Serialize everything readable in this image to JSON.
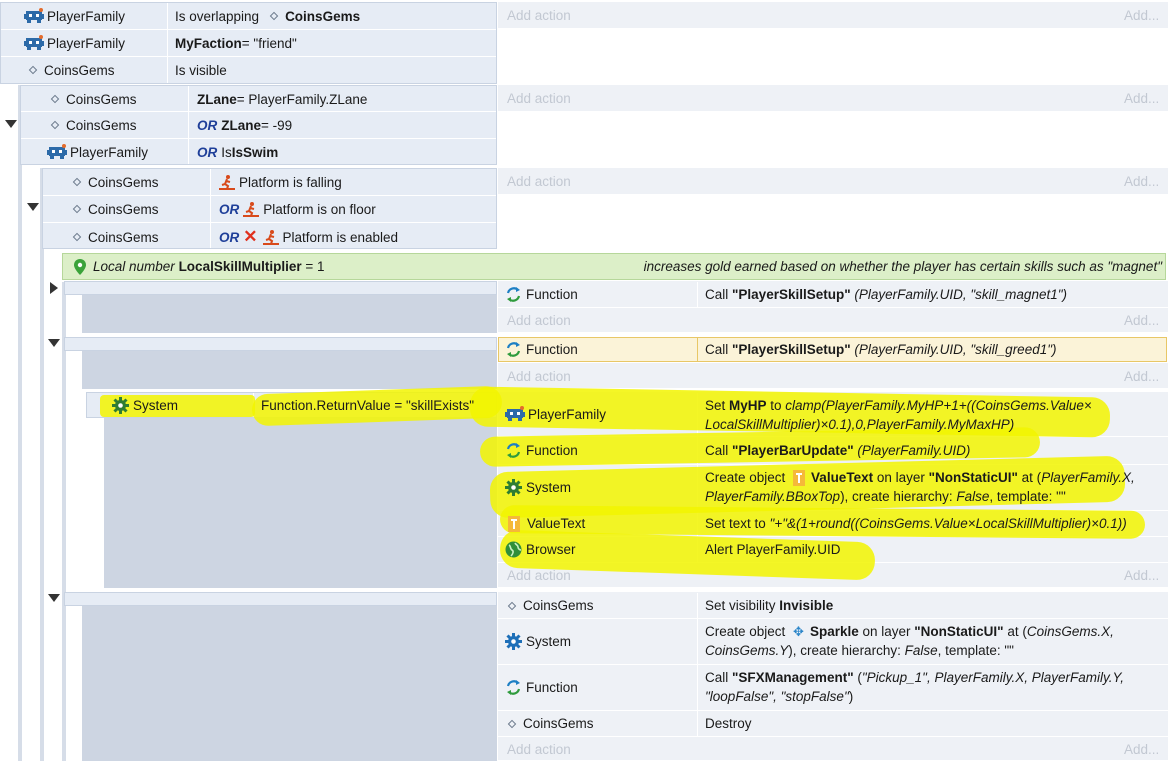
{
  "add_action": "Add action",
  "add_dots": "Add...",
  "block1": {
    "rows": [
      {
        "obj": "PlayerFamily",
        "cond_pre": "Is overlapping",
        "cond_bold": "CoinsGems"
      },
      {
        "obj": "PlayerFamily",
        "cond_bold": "MyFaction",
        "cond_post": " = \"friend\""
      },
      {
        "obj": "CoinsGems",
        "cond": "Is visible"
      }
    ]
  },
  "block2": {
    "rows": [
      {
        "obj": "CoinsGems",
        "cond_bold": "ZLane",
        "cond_post": " = PlayerFamily.ZLane"
      },
      {
        "obj": "CoinsGems",
        "or": "OR",
        "cond_bold": "ZLane",
        "cond_post": " = -99"
      },
      {
        "obj": "PlayerFamily",
        "or": "OR",
        "cond_pre": "Is ",
        "cond_bold": "IsSwim"
      }
    ]
  },
  "block3": {
    "rows": [
      {
        "obj": "CoinsGems",
        "cond": "Platform is falling"
      },
      {
        "obj": "CoinsGems",
        "or": "OR",
        "cond": "Platform is on floor"
      },
      {
        "obj": "CoinsGems",
        "or": "OR",
        "cond": "Platform is enabled"
      }
    ]
  },
  "local_var": {
    "prefix": "Local number ",
    "name": "LocalSkillMultiplier",
    "value": " = 1",
    "comment": "increases gold earned based on whether the player has certain skills such as \"magnet\""
  },
  "ev4": {
    "obj": "Function",
    "pre": "Call ",
    "bold": "\"PlayerSkillSetup\"",
    "args": " (PlayerFamily.UID, \"skill_magnet1\")"
  },
  "ev5": {
    "obj": "Function",
    "pre": "Call ",
    "bold": "\"PlayerSkillSetup\"",
    "args": " (PlayerFamily.UID, \"skill_greed1\")"
  },
  "ev6": {
    "cond_obj": "System",
    "cond": "Function.ReturnValue = \"skillExists\"",
    "a1": {
      "obj": "PlayerFamily",
      "pre": "Set ",
      "bold": "MyHP",
      "mid": " to ",
      "it1": "clamp(PlayerFamily.MyHP+1+((CoinsGems.Value×",
      "it2": "LocalSkillMultiplier)×0.1),0,PlayerFamily.MyMaxHP)"
    },
    "a2": {
      "obj": "Function",
      "pre": "Call ",
      "bold": "\"PlayerBarUpdate\"",
      "args": " (PlayerFamily.UID)"
    },
    "a3": {
      "obj": "System",
      "pre": "Create object ",
      "bold1": "ValueText",
      "mid": " on layer ",
      "bold2": "\"NonStaticUI\"",
      "post": " at (",
      "it": "PlayerFamily.X,",
      "line2it": "PlayerFamily.BBoxTop",
      "line2": "), create hierarchy: ",
      "f": "False",
      "tail": ", template: \"\""
    },
    "a4": {
      "obj": "ValueText",
      "pre": "Set text to ",
      "it": "\"+\"&(1+round((CoinsGems.Value×LocalSkillMultiplier)×0.1))"
    },
    "a5": {
      "obj": "Browser",
      "text": "Alert PlayerFamily.UID"
    }
  },
  "ev7": {
    "a1": {
      "obj": "CoinsGems",
      "pre": "Set visibility ",
      "bold": "Invisible"
    },
    "a2": {
      "obj": "System",
      "pre": "Create object ",
      "bold1": "Sparkle",
      "mid": " on layer ",
      "bold2": "\"NonStaticUI\"",
      "post": " at (",
      "it": "CoinsGems.X,",
      "line2it": "CoinsGems.Y",
      "line2": "), create hierarchy: ",
      "f": "False",
      "tail": ", template: \"\""
    },
    "a3": {
      "obj": "Function",
      "pre": "Call ",
      "bold": "\"SFXManagement\"",
      "post": " (",
      "it": "\"Pickup_1\", PlayerFamily.X, PlayerFamily.Y,",
      "line2it": "\"loopFalse\", \"stopFalse\"",
      "line2": ")"
    },
    "a4": {
      "obj": "CoinsGems",
      "text": "Destroy"
    }
  },
  "colors": {
    "highlight": "#f2f500",
    "or_keyword": "#1f3f99",
    "comment_bg": "#dcefc8",
    "selected_action": "#fbf3d8"
  }
}
